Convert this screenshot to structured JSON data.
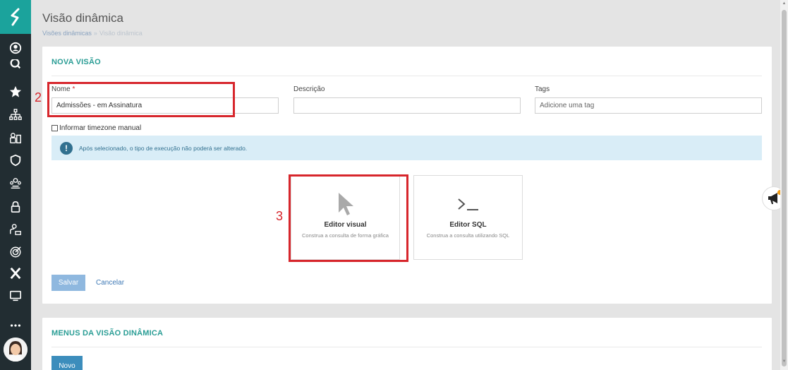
{
  "header": {
    "title": "Visão dinâmica",
    "breadcrumb": {
      "parent": "Visões dinâmicas",
      "separator": "»",
      "current": "Visão dinâmica"
    }
  },
  "sidebar": {
    "icons": [
      "user-circle-icon",
      "search-icon",
      "star-icon",
      "sitemap-icon",
      "people-icon",
      "shield-icon",
      "group-icon",
      "lock-icon",
      "user-lock-icon",
      "target-icon",
      "x-icon",
      "monitor-icon",
      "more-icon"
    ]
  },
  "form": {
    "section_title": "NOVA VISÃO",
    "name_label": "Nome",
    "required_mark": "*",
    "name_value": "Admissões - em Assinatura",
    "description_label": "Descrição",
    "description_value": "",
    "tags_label": "Tags",
    "tags_placeholder": "Adicione uma tag",
    "timezone_checkbox_label": "Informar timezone manual",
    "alert_icon": "!",
    "alert_text": "Após selecionado, o tipo de execução não poderá ser alterado.",
    "cards": [
      {
        "icon": "cursor-icon",
        "title": "Editor visual",
        "description": "Construa a consulta de forma gráfica"
      },
      {
        "icon": "terminal-icon",
        "title": "Editor SQL",
        "description": "Construa a consulta utilizando SQL"
      }
    ],
    "save_label": "Salvar",
    "cancel_label": "Cancelar"
  },
  "menus": {
    "section_title": "MENUS DA VISÃO DINÂMICA",
    "new_label": "Novo"
  },
  "annotations": {
    "name_step": "2",
    "editor_step": "3"
  },
  "colors": {
    "accent": "#1ba39c",
    "title_teal": "#2a9d95",
    "annotation": "#d7262c",
    "sidebar": "#222d32",
    "primary_button": "#3c8dbc",
    "alert_bg": "#d9edf7"
  }
}
